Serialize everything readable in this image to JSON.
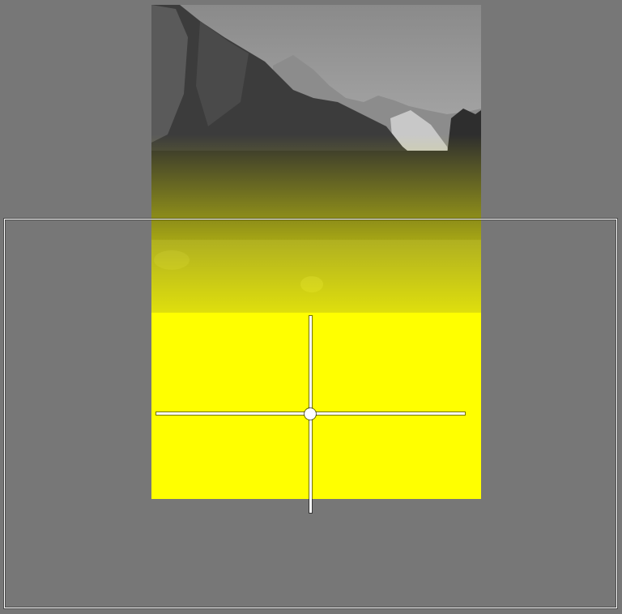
{
  "editor": {
    "canvas_background": "#777777",
    "mask_overlay_color": "#ffff00",
    "photo_mode": "grayscale",
    "photo_description_icon": "mountain-landscape-image",
    "tool": "linear-gradient-mask"
  },
  "mask": {
    "handles": [
      "horizontal-guide",
      "vertical-guide",
      "center-pin"
    ],
    "frame_color": "#ffffff"
  }
}
